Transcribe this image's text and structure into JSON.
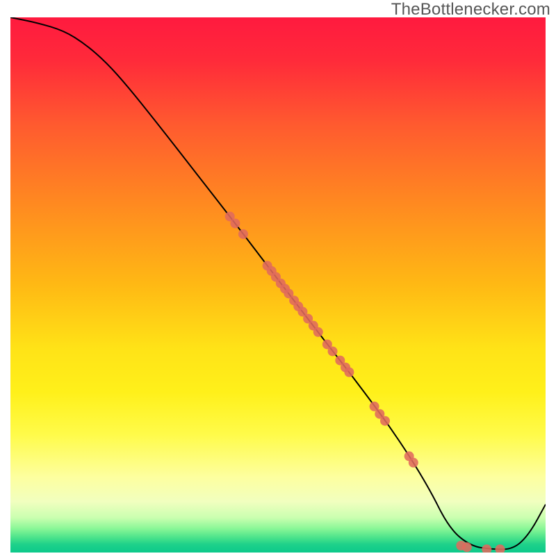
{
  "attribution": "TheBottlenecker.com",
  "chart_data": {
    "type": "line",
    "title": "",
    "xlabel": "",
    "ylabel": "",
    "xlim": [
      0,
      100
    ],
    "ylim": [
      0,
      100
    ],
    "gradient_stops": [
      {
        "offset": 0.0,
        "color": "#ff1a3f"
      },
      {
        "offset": 0.08,
        "color": "#ff2a3a"
      },
      {
        "offset": 0.2,
        "color": "#ff5a2f"
      },
      {
        "offset": 0.35,
        "color": "#ff8a20"
      },
      {
        "offset": 0.5,
        "color": "#ffb914"
      },
      {
        "offset": 0.62,
        "color": "#ffe317"
      },
      {
        "offset": 0.7,
        "color": "#fff01a"
      },
      {
        "offset": 0.78,
        "color": "#fffb4a"
      },
      {
        "offset": 0.86,
        "color": "#fdffa0"
      },
      {
        "offset": 0.905,
        "color": "#f1ffbf"
      },
      {
        "offset": 0.935,
        "color": "#caffb0"
      },
      {
        "offset": 0.955,
        "color": "#8af797"
      },
      {
        "offset": 0.972,
        "color": "#4be38b"
      },
      {
        "offset": 0.985,
        "color": "#1ed18a"
      },
      {
        "offset": 1.0,
        "color": "#0dc98b"
      }
    ],
    "series": [
      {
        "name": "bottleneck-curve",
        "color": "#000000",
        "stroke_width": 2.0,
        "x": [
          0,
          5,
          10,
          14,
          18,
          22,
          28,
          35,
          42,
          50,
          58,
          65,
          72,
          78,
          82,
          86,
          90,
          94,
          97,
          100
        ],
        "y": [
          100,
          99,
          97.5,
          95,
          91.5,
          87,
          79.5,
          70.5,
          61.5,
          51,
          40.5,
          31.5,
          22,
          12.5,
          4.5,
          1.2,
          0.6,
          0.6,
          3.5,
          9
        ]
      }
    ],
    "scatter": {
      "name": "data-points",
      "color": "#e06a5d",
      "radius": 7,
      "points": [
        {
          "x": 41.0,
          "y": 62.8
        },
        {
          "x": 42.0,
          "y": 61.5
        },
        {
          "x": 43.5,
          "y": 59.5
        },
        {
          "x": 48.0,
          "y": 53.6
        },
        {
          "x": 48.8,
          "y": 52.6
        },
        {
          "x": 49.6,
          "y": 51.5
        },
        {
          "x": 50.5,
          "y": 50.3
        },
        {
          "x": 51.3,
          "y": 49.3
        },
        {
          "x": 52.0,
          "y": 48.4
        },
        {
          "x": 53.0,
          "y": 47.1
        },
        {
          "x": 53.8,
          "y": 46.0
        },
        {
          "x": 54.6,
          "y": 45.0
        },
        {
          "x": 55.6,
          "y": 43.7
        },
        {
          "x": 56.6,
          "y": 42.4
        },
        {
          "x": 57.5,
          "y": 41.2
        },
        {
          "x": 59.2,
          "y": 38.9
        },
        {
          "x": 60.2,
          "y": 37.6
        },
        {
          "x": 61.6,
          "y": 35.9
        },
        {
          "x": 62.6,
          "y": 34.6
        },
        {
          "x": 63.3,
          "y": 33.7
        },
        {
          "x": 68.0,
          "y": 27.3
        },
        {
          "x": 69.0,
          "y": 25.9
        },
        {
          "x": 70.0,
          "y": 24.6
        },
        {
          "x": 74.5,
          "y": 18.0
        },
        {
          "x": 75.3,
          "y": 16.8
        },
        {
          "x": 84.2,
          "y": 1.3
        },
        {
          "x": 85.3,
          "y": 1.0
        },
        {
          "x": 89.0,
          "y": 0.6
        },
        {
          "x": 91.5,
          "y": 0.6
        }
      ]
    }
  }
}
